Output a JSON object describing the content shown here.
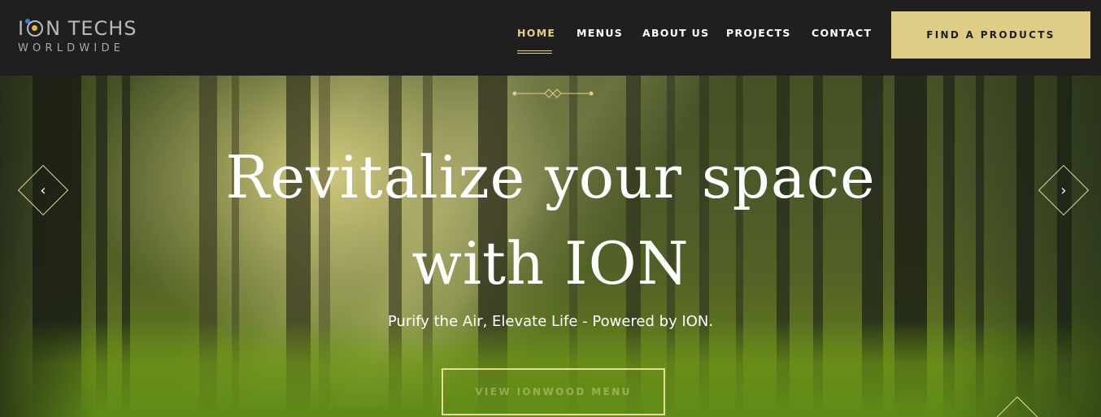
{
  "logo": {
    "line1_a": "I",
    "line1_b": "N TECHS",
    "line2": "WORLDWIDE"
  },
  "nav": {
    "items": [
      {
        "label": "HOME",
        "active": true
      },
      {
        "label": "MENUS",
        "active": false
      },
      {
        "label": "ABOUT US",
        "active": false
      },
      {
        "label": "PROJECTS",
        "active": false
      },
      {
        "label": "CONTACT",
        "active": false
      }
    ],
    "cta_label": "FIND A PRODUCTS"
  },
  "hero": {
    "headline_line1": "Revitalize your space",
    "headline_line2": "with ION",
    "tagline": "Purify the Air, Elevate Life - Powered by ION.",
    "button_label": "VIEW IONWOOD MENU",
    "prev_icon": "chevron-left-icon",
    "next_icon": "chevron-right-icon"
  },
  "colors": {
    "header_bg": "#1f1f1f",
    "accent_gold": "#dfcd86",
    "nav_active": "#e3cf88",
    "text_white": "#ffffff"
  }
}
